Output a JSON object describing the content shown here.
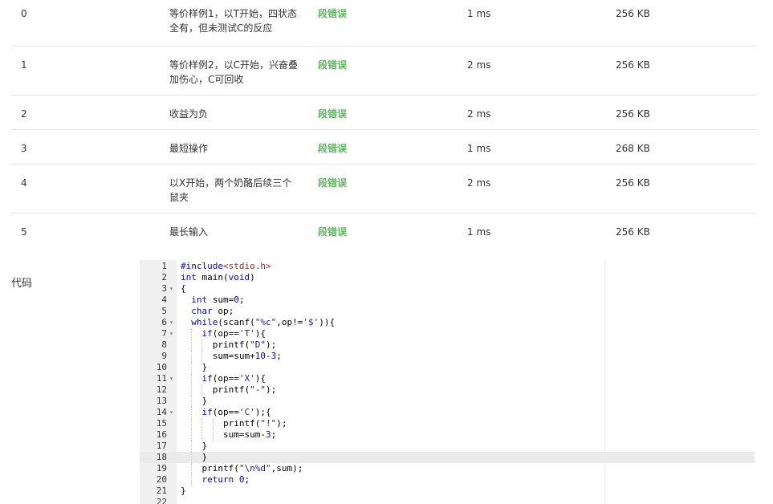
{
  "test_rows": [
    {
      "id": "0",
      "desc_line1": "等价样例1，以T开始，四状态",
      "desc_line2": "全有，但未测试C的反应",
      "status": "段错误",
      "time": "1 ms",
      "memory": "256 KB"
    },
    {
      "id": "1",
      "desc_line1": "等价样例2，以C开始，兴奋叠",
      "desc_line2": "加伤心，C可回收",
      "status": "段错误",
      "time": "2 ms",
      "memory": "256 KB"
    },
    {
      "id": "2",
      "desc_line1": "收益为负",
      "desc_line2": "",
      "status": "段错误",
      "time": "2 ms",
      "memory": "256 KB"
    },
    {
      "id": "3",
      "desc_line1": "最短操作",
      "desc_line2": "",
      "status": "段错误",
      "time": "1 ms",
      "memory": "268 KB"
    },
    {
      "id": "4",
      "desc_line1": "以X开始，两个奶酪后续三个",
      "desc_line2": "鼠夹",
      "status": "段错误",
      "time": "2 ms",
      "memory": "256 KB"
    },
    {
      "id": "5",
      "desc_line1": "最长输入",
      "desc_line2": "",
      "status": "段错误",
      "time": "1 ms",
      "memory": "256 KB"
    }
  ],
  "code_section": {
    "label": "代码",
    "active_line": 18,
    "lines": [
      "#include<stdio.h>",
      "int main(void)",
      "{",
      "  int sum=0;",
      "  char op;",
      "  while(scanf(\"%c\",op!='$')){",
      "    if(op=='T'){",
      "      printf(\"D\");",
      "      sum=sum+10-3;",
      "    }",
      "    if(op=='X'){",
      "      printf(\"-\");",
      "    }",
      "    if(op=='C');{",
      "        printf(\"!\");",
      "        sum=sum-3;",
      "    }",
      "    }",
      "    printf(\"\\n%d\",sum);",
      "    return 0;",
      "}",
      ""
    ],
    "fold_lines": [
      3,
      6,
      7,
      11,
      14
    ],
    "colors": {
      "keyword": "#0000ff",
      "string": "#1a1aa6",
      "number": "#0000cd",
      "include_target": "#a52a2a",
      "status_error": "#5cb85c"
    }
  }
}
